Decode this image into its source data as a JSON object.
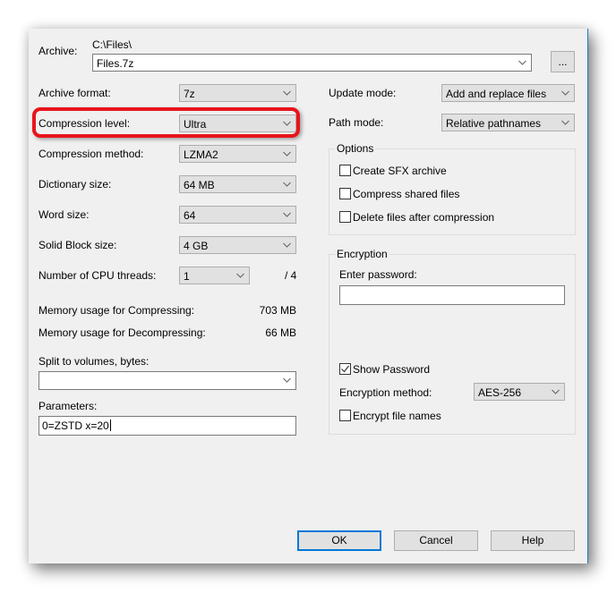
{
  "archive": {
    "label": "Archive:",
    "path": "C:\\Files\\",
    "filename": "Files.7z",
    "browse_label": "..."
  },
  "left": {
    "archive_format": {
      "label": "Archive format:",
      "value": "7z"
    },
    "compression_level": {
      "label": "Compression level:",
      "value": "Ultra"
    },
    "compression_method": {
      "label": "Compression method:",
      "value": "LZMA2"
    },
    "dictionary_size": {
      "label": "Dictionary size:",
      "value": "64 MB"
    },
    "word_size": {
      "label": "Word size:",
      "value": "64"
    },
    "solid_block_size": {
      "label": "Solid Block size:",
      "value": "4 GB"
    },
    "cpu_threads": {
      "label": "Number of CPU threads:",
      "value": "1",
      "max": "/ 4"
    },
    "memory_compress": {
      "label": "Memory usage for Compressing:",
      "value": "703 MB"
    },
    "memory_decompress": {
      "label": "Memory usage for Decompressing:",
      "value": "66 MB"
    },
    "split_volumes": {
      "label": "Split to volumes, bytes:",
      "value": ""
    },
    "parameters": {
      "label": "Parameters:",
      "value": "0=ZSTD x=20"
    }
  },
  "right": {
    "update_mode": {
      "label": "Update mode:",
      "value": "Add and replace files"
    },
    "path_mode": {
      "label": "Path mode:",
      "value": "Relative pathnames"
    },
    "options": {
      "title": "Options",
      "items": [
        {
          "label": "Create SFX archive",
          "checked": false
        },
        {
          "label": "Compress shared files",
          "checked": false
        },
        {
          "label": "Delete files after compression",
          "checked": false
        }
      ]
    },
    "encryption": {
      "title": "Encryption",
      "password_label": "Enter password:",
      "password_value": "",
      "show_password": {
        "label": "Show Password",
        "checked": true
      },
      "method_label": "Encryption method:",
      "method_value": "AES-256",
      "encrypt_names": {
        "label": "Encrypt file names",
        "checked": false
      }
    }
  },
  "buttons": {
    "ok": "OK",
    "cancel": "Cancel",
    "help": "Help"
  },
  "colors": {
    "highlight": "#e8141c",
    "accent": "#0078d7"
  }
}
